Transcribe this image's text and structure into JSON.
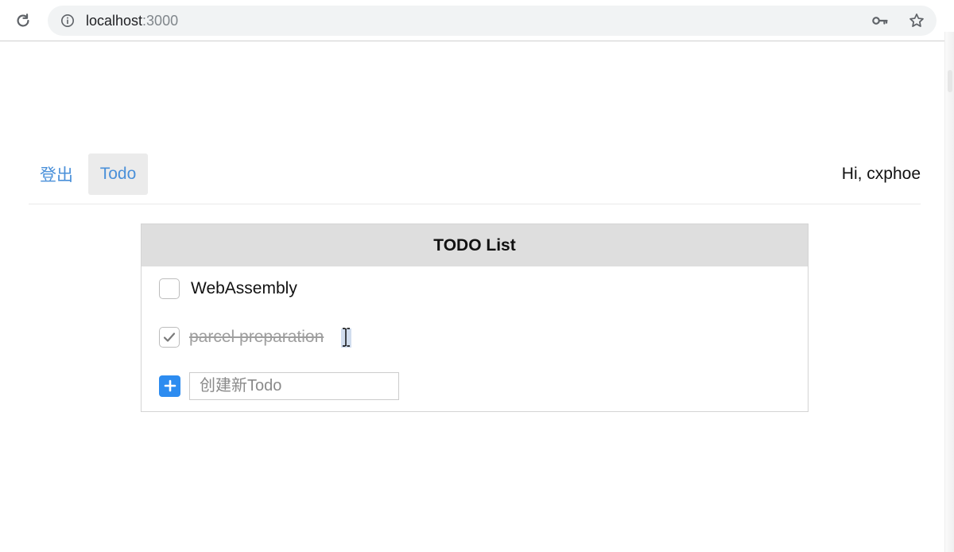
{
  "browser": {
    "url_host": "localhost",
    "url_port": ":3000",
    "icons": [
      "reload-icon",
      "info-icon",
      "key-icon",
      "star-icon"
    ]
  },
  "nav": {
    "logout_label": "登出",
    "todo_label": "Todo",
    "greeting": "Hi, cxphoe"
  },
  "todo": {
    "title": "TODO List",
    "items": [
      {
        "text": "WebAssembly",
        "done": false
      },
      {
        "text": "parcel preparation",
        "done": true
      }
    ],
    "new_placeholder": "创建新Todo"
  },
  "colors": {
    "link": "#4a90d9",
    "header_bg": "#dedede",
    "add_button": "#2d8cf0"
  }
}
